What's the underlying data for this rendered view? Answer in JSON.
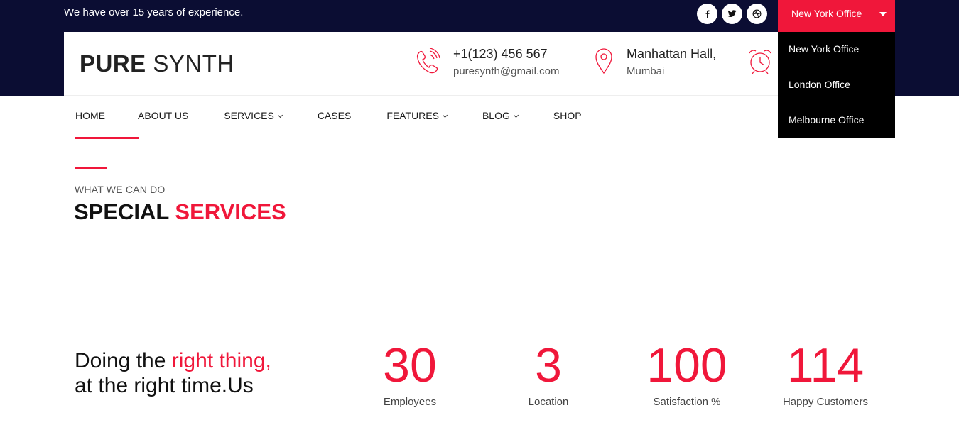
{
  "topbar": {
    "tagline": "We have over 15 years of experience.",
    "socials": [
      {
        "icon": "facebook-icon"
      },
      {
        "icon": "twitter-icon"
      },
      {
        "icon": "dribbble-icon"
      }
    ],
    "office": {
      "selected": "New York Office",
      "options": [
        "New York Office",
        "London Office",
        "Melbourne Office"
      ]
    }
  },
  "header": {
    "logo_bold": "PURE",
    "logo_light": " SYNTH",
    "phone": "+1(123) 456 567",
    "email": "puresynth@gmail.com",
    "address_line1": "Manhattan Hall,",
    "address_line2": "Mumbai"
  },
  "nav": {
    "items": [
      "HOME",
      "ABOUT US",
      "SERVICES",
      "CASES",
      "FEATURES",
      "BLOG",
      "SHOP"
    ],
    "active": "HOME"
  },
  "section": {
    "subtitle": "WHAT WE CAN DO",
    "title_main": "SPECIAL ",
    "title_accent": "SERVICES"
  },
  "counter": {
    "line1_main": "Doing the ",
    "line1_accent": "right thing,",
    "line2": "at the right time.Us",
    "stats": [
      {
        "value": "30",
        "label": "Employees"
      },
      {
        "value": "3",
        "label": "Location"
      },
      {
        "value": "100",
        "label": "Satisfaction %"
      },
      {
        "value": "114",
        "label": "Happy Customers"
      }
    ]
  },
  "colors": {
    "accent": "#f0173a",
    "dark": "#0b0d33"
  }
}
